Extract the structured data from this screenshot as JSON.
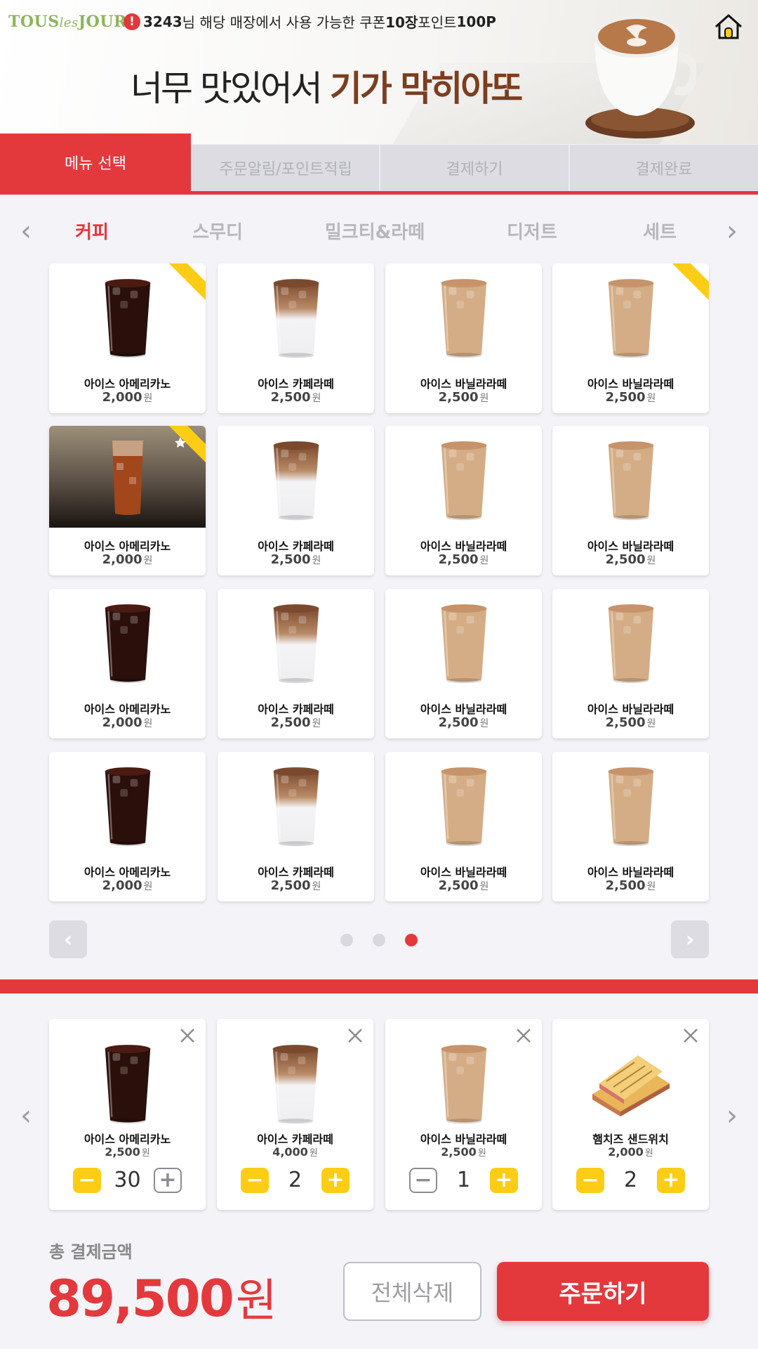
{
  "header": {
    "logo_main": "TOUS",
    "logo_les": "les",
    "logo_end": "JOURS",
    "alert_glyph": "!",
    "notice_user": "3243",
    "notice_text_1": "님 해당 매장에서 사용 가능한 쿠폰 ",
    "notice_coupon": "10장",
    "notice_text_2": " 포인트 ",
    "notice_points": "100P",
    "banner_light": "너무 맛있어서 ",
    "banner_bold": "기가 막히아또",
    "home_icon": "home-icon"
  },
  "steps": [
    {
      "label": "메뉴 선택",
      "active": true
    },
    {
      "label": "주문알림/포인트적립",
      "active": false
    },
    {
      "label": "결제하기",
      "active": false
    },
    {
      "label": "결제완료",
      "active": false
    }
  ],
  "categories": [
    {
      "label": "커피",
      "active": true
    },
    {
      "label": "스무디",
      "active": false
    },
    {
      "label": "밀크티&라떼",
      "active": false
    },
    {
      "label": "디저트",
      "active": false
    },
    {
      "label": "세트",
      "active": false
    }
  ],
  "currency_unit": "원",
  "products": [
    {
      "name": "아이스 아메리카노",
      "price": "2,000",
      "drink": "americano",
      "starred": true
    },
    {
      "name": "아이스 카페라떼",
      "price": "2,500",
      "drink": "latte",
      "starred": false
    },
    {
      "name": "아이스 바닐라라떼",
      "price": "2,500",
      "drink": "vanilla",
      "starred": false
    },
    {
      "name": "아이스 바닐라라떼",
      "price": "2,500",
      "drink": "vanilla",
      "starred": true
    },
    {
      "name": "아이스 아메리카노",
      "price": "2,000",
      "drink": "photo",
      "starred": true
    },
    {
      "name": "아이스 카페라떼",
      "price": "2,500",
      "drink": "latte",
      "starred": false
    },
    {
      "name": "아이스 바닐라라떼",
      "price": "2,500",
      "drink": "vanilla",
      "starred": false
    },
    {
      "name": "아이스 바닐라라떼",
      "price": "2,500",
      "drink": "vanilla",
      "starred": false
    },
    {
      "name": "아이스 아메리카노",
      "price": "2,000",
      "drink": "americano",
      "starred": false
    },
    {
      "name": "아이스 카페라떼",
      "price": "2,500",
      "drink": "latte",
      "starred": false
    },
    {
      "name": "아이스 바닐라라떼",
      "price": "2,500",
      "drink": "vanilla",
      "starred": false
    },
    {
      "name": "아이스 바닐라라떼",
      "price": "2,500",
      "drink": "vanilla",
      "starred": false
    },
    {
      "name": "아이스 아메리카노",
      "price": "2,000",
      "drink": "americano",
      "starred": false
    },
    {
      "name": "아이스 카페라떼",
      "price": "2,500",
      "drink": "latte",
      "starred": false
    },
    {
      "name": "아이스 바닐라라떼",
      "price": "2,500",
      "drink": "vanilla",
      "starred": false
    },
    {
      "name": "아이스 바닐라라떼",
      "price": "2,500",
      "drink": "vanilla",
      "starred": false
    }
  ],
  "pagination": {
    "pages": 3,
    "current": 3
  },
  "cart": [
    {
      "name": "아이스 아메리카노",
      "price": "2,500",
      "qty": "30",
      "drink": "americano",
      "minus_enabled": true,
      "plus_enabled": false
    },
    {
      "name": "아이스 카페라떼",
      "price": "4,000",
      "qty": "2",
      "drink": "latte",
      "minus_enabled": true,
      "plus_enabled": true
    },
    {
      "name": "아이스 바닐라라떼",
      "price": "2,500",
      "qty": "1",
      "drink": "vanilla",
      "minus_enabled": false,
      "plus_enabled": true
    },
    {
      "name": "햄치즈 샌드위치",
      "price": "2,000",
      "qty": "2",
      "drink": "sandwich",
      "minus_enabled": true,
      "plus_enabled": true
    }
  ],
  "total": {
    "label": "총 결제금액",
    "amount": "89,500",
    "unit": "원"
  },
  "buttons": {
    "clear": "전체삭제",
    "order": "주문하기"
  },
  "colors": {
    "accent_red": "#e3393d",
    "star_yellow": "#fccd14",
    "logo_green": "#8eb55a",
    "banner_brown": "#7b3e1f"
  }
}
